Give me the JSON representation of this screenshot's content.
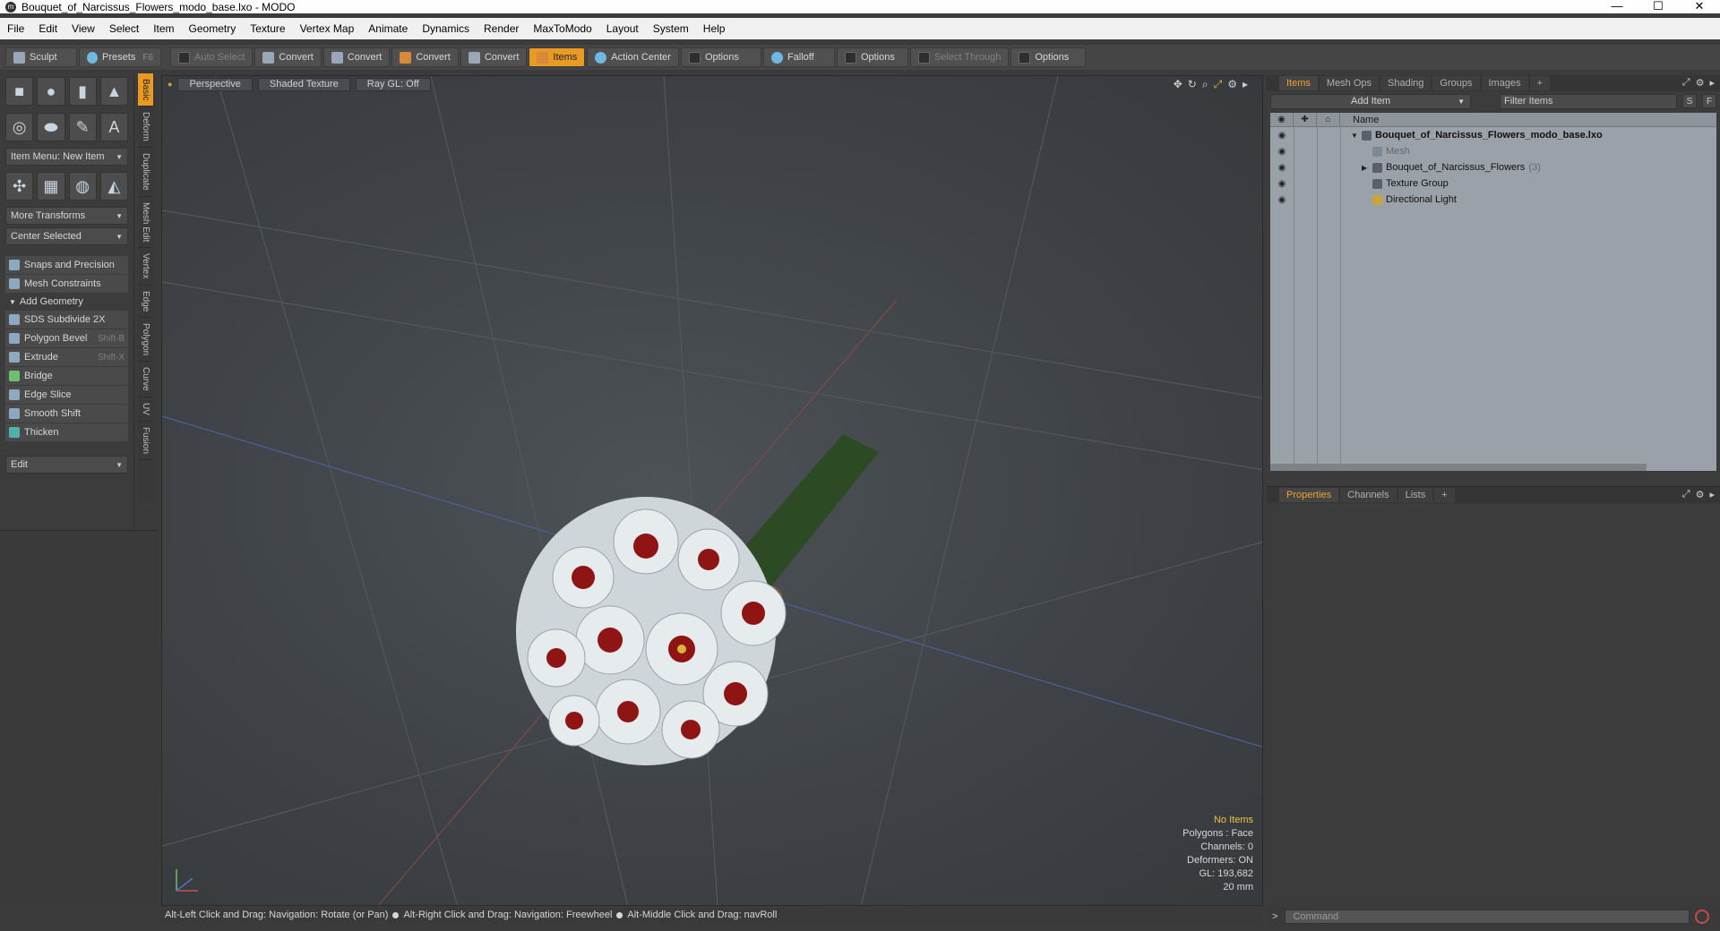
{
  "window": {
    "title": "Bouquet_of_Narcissus_Flowers_modo_base.lxo - MODO",
    "app_icon": "modo-logo-icon",
    "controls": [
      "—",
      "☐",
      "✕"
    ]
  },
  "menu": [
    "File",
    "Edit",
    "View",
    "Select",
    "Item",
    "Geometry",
    "Texture",
    "Vertex Map",
    "Animate",
    "Dynamics",
    "Render",
    "MaxToModo",
    "Layout",
    "System",
    "Help"
  ],
  "toolbar": {
    "sculpt": "Sculpt",
    "presets": "Presets",
    "presets_hint": "F6",
    "auto_select": "Auto Select",
    "convert1": "Convert",
    "convert2": "Convert",
    "convert3": "Convert",
    "convert4": "Convert",
    "items": "Items",
    "action_center": "Action Center",
    "options1": "Options",
    "falloff": "Falloff",
    "options2": "Options",
    "select_through": "Select Through",
    "options3": "Options"
  },
  "left_panel": {
    "item_menu": "Item Menu: New Item",
    "more_transforms": "More Transforms",
    "center_selected": "Center Selected",
    "snaps": "Snaps and Precision",
    "mesh_constraints": "Mesh Constraints",
    "add_geometry": "Add Geometry",
    "tools": [
      {
        "label": "SDS Subdivide 2X",
        "shortcut": ""
      },
      {
        "label": "Polygon Bevel",
        "shortcut": "Shift-B"
      },
      {
        "label": "Extrude",
        "shortcut": "Shift-X"
      },
      {
        "label": "Bridge",
        "shortcut": ""
      },
      {
        "label": "Edge Slice",
        "shortcut": ""
      },
      {
        "label": "Smooth Shift",
        "shortcut": ""
      },
      {
        "label": "Thicken",
        "shortcut": ""
      }
    ],
    "edit_dropdown": "Edit",
    "vertical_tabs": [
      "Basic",
      "Deform",
      "Duplicate",
      "Mesh Edit",
      "Vertex",
      "Edge",
      "Polygon",
      "Curve",
      "UV",
      "Fusion"
    ]
  },
  "viewport": {
    "view": "Perspective",
    "shading": "Shaded Texture",
    "raygl": "Ray GL: Off",
    "hud": {
      "selection": "No Items",
      "polygons": "Polygons : Face",
      "channels": "Channels: 0",
      "deformers": "Deformers: ON",
      "gl": "GL: 193,682",
      "scale": "20 mm"
    }
  },
  "status": {
    "hint1": "Alt-Left Click and Drag: Navigation: Rotate (or Pan)",
    "hint2": "Alt-Right Click and Drag: Navigation: Freewheel",
    "hint3": "Alt-Middle Click and Drag: navRoll"
  },
  "items_panel": {
    "tabs": [
      "Items",
      "Mesh Ops",
      "Shading",
      "Groups",
      "Images",
      "+"
    ],
    "add_item": "Add Item",
    "filter_placeholder": "Filter Items",
    "btn_s": "S",
    "btn_f": "F",
    "column_name": "Name",
    "rows": [
      {
        "label": "Bouquet_of_Narcissus_Flowers_modo_base.lxo",
        "count": ""
      },
      {
        "label": "Mesh",
        "count": ""
      },
      {
        "label": "Bouquet_of_Narcissus_Flowers",
        "count": "(3)"
      },
      {
        "label": "Texture Group",
        "count": ""
      },
      {
        "label": "Directional Light",
        "count": ""
      }
    ]
  },
  "properties_panel": {
    "tabs": [
      "Properties",
      "Channels",
      "Lists",
      "+"
    ]
  },
  "command": {
    "placeholder": "Command"
  },
  "colors": {
    "accent": "#e89a23",
    "viewport_bg": "#41454a",
    "tree_bg": "#9aa1a8"
  }
}
